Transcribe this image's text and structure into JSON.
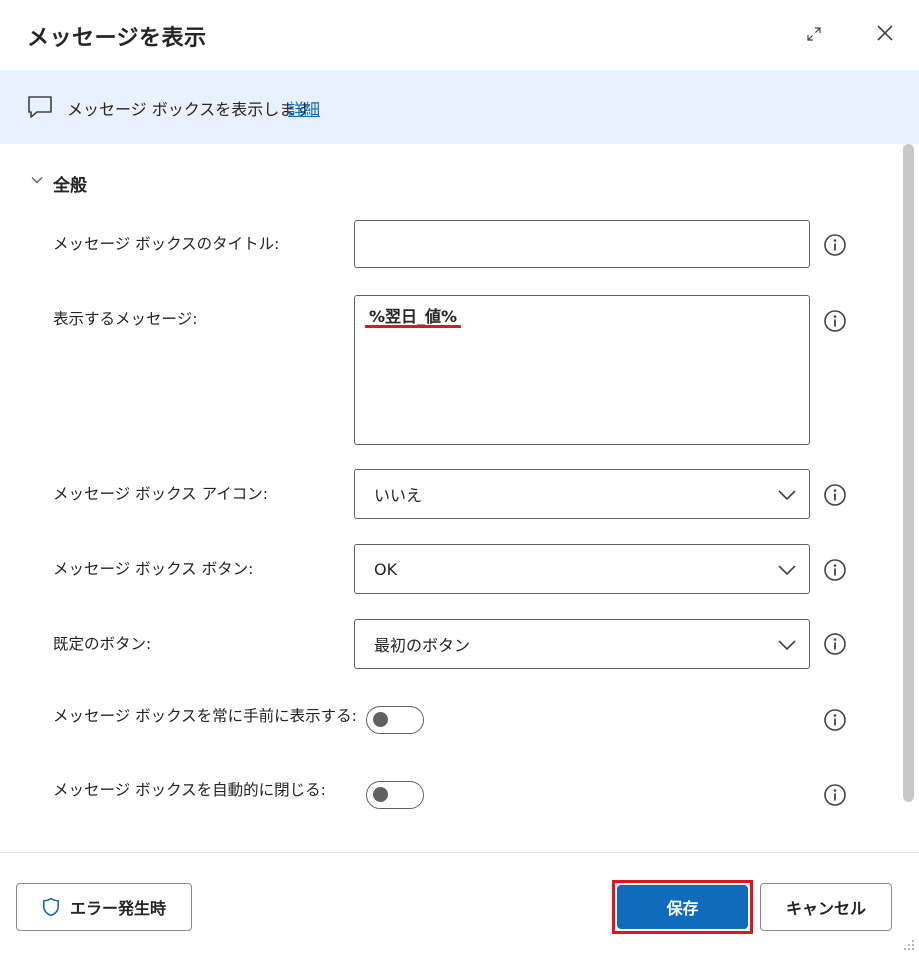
{
  "dialog": {
    "title": "メッセージを表示"
  },
  "banner": {
    "text": "メッセージ ボックスを表示します",
    "link": "詳細"
  },
  "section": {
    "title": "全般"
  },
  "fields": {
    "msgbox_title_label": "メッセージ ボックスのタイトル:",
    "msgbox_title_value": "",
    "message_label": "表示するメッセージ:",
    "message_value": "%翌日_値%",
    "icon_label": "メッセージ ボックス アイコン:",
    "icon_value": "いいえ",
    "buttons_label": "メッセージ ボックス ボタン:",
    "buttons_value": "OK",
    "default_button_label": "既定のボタン:",
    "default_button_value": "最初のボタン",
    "topmost_label": "メッセージ ボックスを常に手前に表示する:",
    "topmost_on": false,
    "autoclose_label": "メッセージ ボックスを自動的に閉じる:",
    "autoclose_on": false
  },
  "footer": {
    "on_error": "エラー発生時",
    "save": "保存",
    "cancel": "キャンセル"
  },
  "colors": {
    "accent": "#0f6cbd",
    "banner_bg": "#e8f1fd",
    "highlight": "#e81123"
  }
}
